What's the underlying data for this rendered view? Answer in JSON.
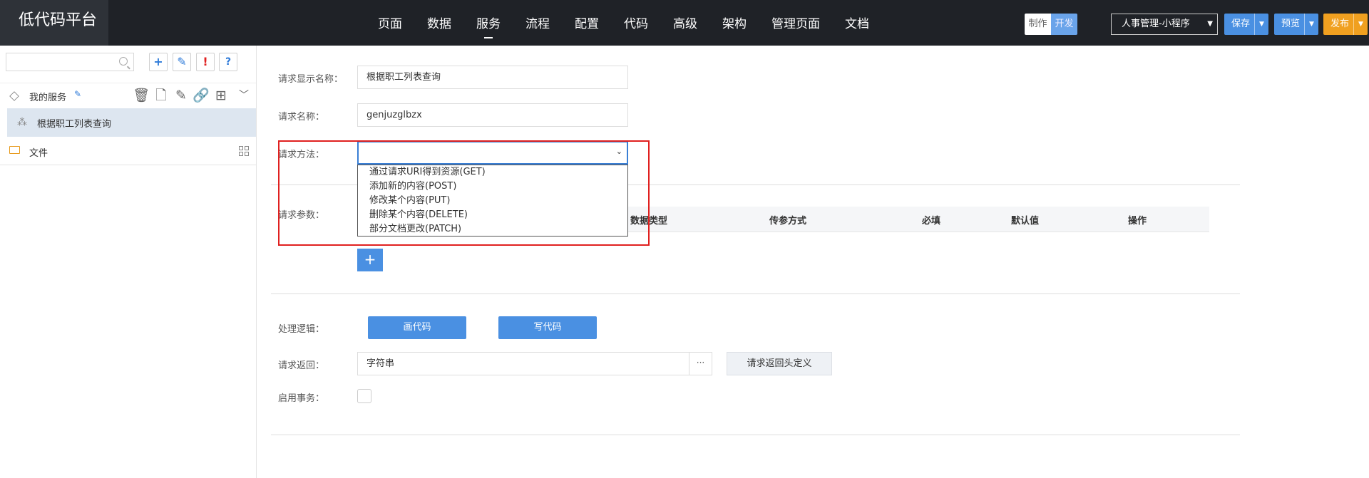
{
  "app": {
    "logo": "低代码平台"
  },
  "nav": [
    "页面",
    "数据",
    "服务",
    "流程",
    "配置",
    "代码",
    "高级",
    "架构",
    "管理页面",
    "文档"
  ],
  "nav_active": "服务",
  "mode": {
    "make": "制作",
    "dev": "开发"
  },
  "app_select": {
    "value": "人事管理-小程序"
  },
  "actions": {
    "save": "保存",
    "preview": "预览",
    "publish": "发布"
  },
  "sidebar": {
    "search_placeholder": "",
    "tree_title": "我的服务",
    "service_item": "根据职工列表查询",
    "file_label": "文件"
  },
  "form": {
    "display_name_label": "请求显示名称：",
    "display_name_value": "根据职工列表查询",
    "name_label": "请求名称：",
    "name_value": "genjuzglbzx",
    "method_label": "请求方法：",
    "method_value": "",
    "method_options": [
      "通过请求URI得到资源(GET)",
      "添加新的内容(POST)",
      "修改某个内容(PUT)",
      "删除某个内容(DELETE)",
      "部分文档更改(PATCH)"
    ],
    "params_label": "请求参数：",
    "params_columns": [
      "数据类型",
      "传参方式",
      "必填",
      "默认值",
      "操作"
    ],
    "add_param": "+",
    "logic_label": "处理逻辑：",
    "draw_code": "画代码",
    "write_code": "写代码",
    "return_label": "请求返回：",
    "return_value": "字符串",
    "return_more": "···",
    "return_header": "请求返回头定义",
    "transaction_label": "启用事务："
  }
}
